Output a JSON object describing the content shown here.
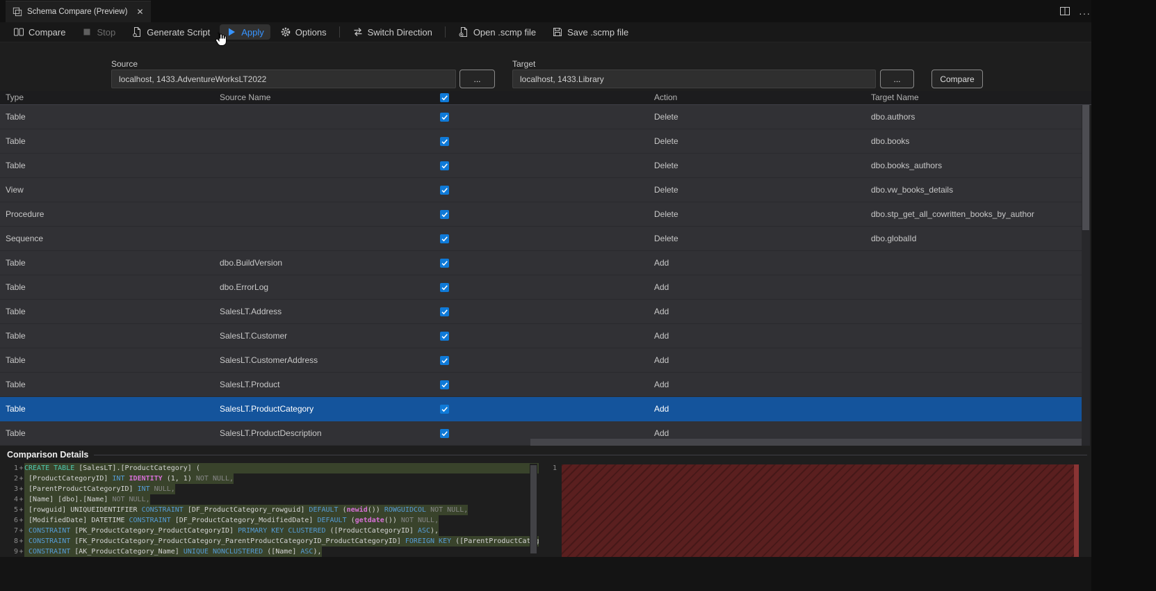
{
  "tab": {
    "title": "Schema Compare (Preview)",
    "close_glyph": "✕"
  },
  "window_controls": {
    "more_glyph": "···"
  },
  "toolbar": {
    "items": [
      {
        "id": "compare",
        "label": "Compare",
        "icon": "compare",
        "enabled": true
      },
      {
        "id": "stop",
        "label": "Stop",
        "icon": "stop",
        "enabled": false
      },
      {
        "id": "generate-script",
        "label": "Generate Script",
        "icon": "script",
        "enabled": true
      },
      {
        "id": "apply",
        "label": "Apply",
        "icon": "play",
        "enabled": true,
        "accent": true,
        "hovered": true
      },
      {
        "id": "options",
        "label": "Options",
        "icon": "gear",
        "enabled": true,
        "sep_after": true
      },
      {
        "id": "switch-direction",
        "label": "Switch Direction",
        "icon": "switch",
        "enabled": true,
        "sep_after": true
      },
      {
        "id": "open-scmp-file",
        "label": "Open .scmp file",
        "icon": "openfile",
        "enabled": true
      },
      {
        "id": "save-scmp-file",
        "label": "Save .scmp file",
        "icon": "save",
        "enabled": true
      }
    ]
  },
  "connection": {
    "source_label": "Source",
    "source_value": "localhost, 1433.AdventureWorksLT2022",
    "target_label": "Target",
    "target_value": "localhost, 1433.Library",
    "browse_label": "...",
    "compare_button_label": "Compare"
  },
  "grid": {
    "headers": {
      "type": "Type",
      "source": "Source Name",
      "action": "Action",
      "target": "Target Name"
    },
    "header_checkbox_checked": true,
    "rows": [
      {
        "type": "Table",
        "source": "",
        "checked": true,
        "action": "Delete",
        "target": "dbo.authors"
      },
      {
        "type": "Table",
        "source": "",
        "checked": true,
        "action": "Delete",
        "target": "dbo.books"
      },
      {
        "type": "Table",
        "source": "",
        "checked": true,
        "action": "Delete",
        "target": "dbo.books_authors"
      },
      {
        "type": "View",
        "source": "",
        "checked": true,
        "action": "Delete",
        "target": "dbo.vw_books_details"
      },
      {
        "type": "Procedure",
        "source": "",
        "checked": true,
        "action": "Delete",
        "target": "dbo.stp_get_all_cowritten_books_by_author"
      },
      {
        "type": "Sequence",
        "source": "",
        "checked": true,
        "action": "Delete",
        "target": "dbo.globalId"
      },
      {
        "type": "Table",
        "source": "dbo.BuildVersion",
        "checked": true,
        "action": "Add",
        "target": ""
      },
      {
        "type": "Table",
        "source": "dbo.ErrorLog",
        "checked": true,
        "action": "Add",
        "target": ""
      },
      {
        "type": "Table",
        "source": "SalesLT.Address",
        "checked": true,
        "action": "Add",
        "target": ""
      },
      {
        "type": "Table",
        "source": "SalesLT.Customer",
        "checked": true,
        "action": "Add",
        "target": ""
      },
      {
        "type": "Table",
        "source": "SalesLT.CustomerAddress",
        "checked": true,
        "action": "Add",
        "target": ""
      },
      {
        "type": "Table",
        "source": "SalesLT.Product",
        "checked": true,
        "action": "Add",
        "target": ""
      },
      {
        "type": "Table",
        "source": "SalesLT.ProductCategory",
        "checked": true,
        "action": "Add",
        "target": "",
        "selected": true
      },
      {
        "type": "Table",
        "source": "SalesLT.ProductDescription",
        "checked": true,
        "action": "Add",
        "target": ""
      }
    ]
  },
  "details": {
    "title": "Comparison Details",
    "left": {
      "lines": [
        {
          "n": "1",
          "s": "+",
          "full": true,
          "seg": [
            [
              "CREATE TABLE",
              "t"
            ],
            [
              " [SalesLT].[ProductCategory] (",
              "w"
            ]
          ]
        },
        {
          "n": "2",
          "s": "+",
          "full": false,
          "seg": [
            [
              " [ProductCategoryID] ",
              "w"
            ],
            [
              "INT",
              "k"
            ],
            [
              " ",
              "w"
            ],
            [
              "IDENTITY",
              "m"
            ],
            [
              " (1, 1) ",
              "w"
            ],
            [
              "NOT NULL,",
              "g"
            ]
          ]
        },
        {
          "n": "3",
          "s": "+",
          "full": false,
          "seg": [
            [
              " [ParentProductCategoryID] ",
              "w"
            ],
            [
              "INT",
              "k"
            ],
            [
              " ",
              "w"
            ],
            [
              "NULL,",
              "g"
            ]
          ]
        },
        {
          "n": "4",
          "s": "+",
          "full": false,
          "seg": [
            [
              " [Name] [dbo].[Name] ",
              "w"
            ],
            [
              "NOT NULL,",
              "g"
            ]
          ]
        },
        {
          "n": "5",
          "s": "+",
          "full": false,
          "seg": [
            [
              " [rowguid] UNIQUEIDENTIFIER ",
              "w"
            ],
            [
              "CONSTRAINT",
              "k"
            ],
            [
              " [DF_ProductCategory_rowguid] ",
              "w"
            ],
            [
              "DEFAULT",
              "k"
            ],
            [
              " (",
              "w"
            ],
            [
              "newid",
              "m"
            ],
            [
              "()) ",
              "w"
            ],
            [
              "ROWGUIDCOL",
              "k"
            ],
            [
              " ",
              "w"
            ],
            [
              "NOT NULL,",
              "g"
            ]
          ]
        },
        {
          "n": "6",
          "s": "+",
          "full": false,
          "seg": [
            [
              " [ModifiedDate] DATETIME ",
              "w"
            ],
            [
              "CONSTRAINT",
              "k"
            ],
            [
              " [DF_ProductCategory_ModifiedDate] ",
              "w"
            ],
            [
              "DEFAULT",
              "k"
            ],
            [
              " (",
              "w"
            ],
            [
              "getdate",
              "m"
            ],
            [
              "()) ",
              "w"
            ],
            [
              "NOT NULL,",
              "g"
            ]
          ]
        },
        {
          "n": "7",
          "s": "+",
          "full": false,
          "seg": [
            [
              " ",
              "w"
            ],
            [
              "CONSTRAINT",
              "k"
            ],
            [
              " [PK_ProductCategory_ProductCategoryID] ",
              "w"
            ],
            [
              "PRIMARY KEY CLUSTERED",
              "k"
            ],
            [
              " ([ProductCategoryID] ",
              "w"
            ],
            [
              "ASC",
              "k"
            ],
            [
              "),",
              "w"
            ]
          ]
        },
        {
          "n": "8",
          "s": "+",
          "full": true,
          "seg": [
            [
              " ",
              "w"
            ],
            [
              "CONSTRAINT",
              "k"
            ],
            [
              " [FK_ProductCategory_ProductCategory_ParentProductCategoryID_ProductCategoryID] ",
              "w"
            ],
            [
              "FOREIGN KEY",
              "k"
            ],
            [
              " ([ParentProductCatego",
              "w"
            ]
          ]
        },
        {
          "n": "9",
          "s": "+",
          "full": false,
          "seg": [
            [
              " ",
              "w"
            ],
            [
              "CONSTRAINT",
              "k"
            ],
            [
              " [AK_ProductCategory_Name] ",
              "w"
            ],
            [
              "UNIQUE NONCLUSTERED",
              "k"
            ],
            [
              " ([Name] ",
              "w"
            ],
            [
              "ASC",
              "k"
            ],
            [
              "),",
              "w"
            ]
          ]
        }
      ]
    },
    "right": {
      "line_number": "1"
    }
  },
  "colors": {
    "accent_blue": "#3794ff",
    "selection_blue": "#14549c",
    "checkbox_blue": "#0f7ad8",
    "diff_added_bg": "#39432b",
    "diff_removed_bg": "#5a1f1f"
  }
}
